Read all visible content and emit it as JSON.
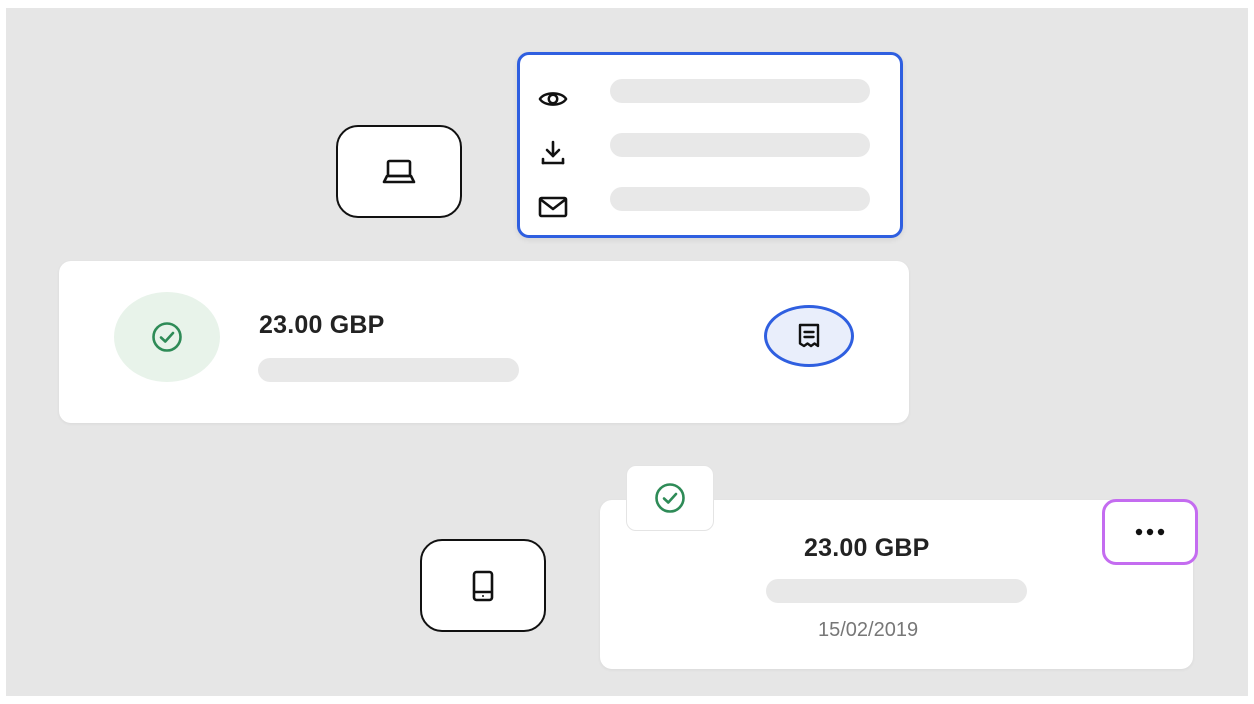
{
  "colors": {
    "background": "#e6e6e6",
    "card": "#ffffff",
    "menu_border": "#2f5fe0",
    "success_green": "#2e8b57",
    "success_bg": "#e8f3ea",
    "receipt_bg": "#e9eefb",
    "more_border": "#c46cf0",
    "skeleton": "#e8e8e8"
  },
  "icons": {
    "desktop": "laptop-icon",
    "mobile": "phone-icon",
    "menu_view": "eye-icon",
    "menu_download": "download-icon",
    "menu_email": "mail-icon",
    "status": "check-circle-icon",
    "receipt": "receipt-icon",
    "more": "more-horizontal-icon"
  },
  "desktop_card": {
    "amount": "23.00 GBP"
  },
  "mobile_card": {
    "amount": "23.00 GBP",
    "date": "15/02/2019"
  }
}
